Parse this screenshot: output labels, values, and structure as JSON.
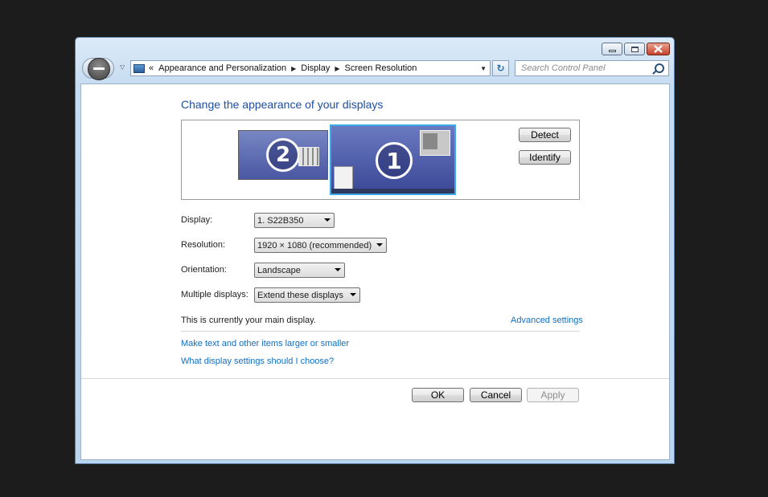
{
  "breadcrumb": {
    "items": [
      "Appearance and Personalization",
      "Display",
      "Screen Resolution"
    ]
  },
  "search": {
    "placeholder": "Search Control Panel"
  },
  "main": {
    "heading": "Change the appearance of your displays",
    "monitors": [
      {
        "number": "2",
        "selected": false
      },
      {
        "number": "1",
        "selected": true
      }
    ],
    "detect_label": "Detect",
    "identify_label": "Identify",
    "fields": {
      "display": {
        "label": "Display:",
        "value": "1. S22B350"
      },
      "resolution": {
        "label": "Resolution:",
        "value": "1920 × 1080 (recommended)"
      },
      "orientation": {
        "label": "Orientation:",
        "value": "Landscape"
      },
      "multiple": {
        "label": "Multiple displays:",
        "value": "Extend these displays"
      }
    },
    "status_text": "This is currently your main display.",
    "advanced_link": "Advanced settings",
    "links": [
      "Make text and other items larger or smaller",
      "What display settings should I choose?"
    ]
  },
  "footer": {
    "ok_label": "OK",
    "cancel_label": "Cancel",
    "apply_label": "Apply"
  },
  "colors": {
    "link": "#0f6fc6",
    "heading": "#1e4fa0",
    "selected_monitor_border": "#3ba9e6"
  }
}
